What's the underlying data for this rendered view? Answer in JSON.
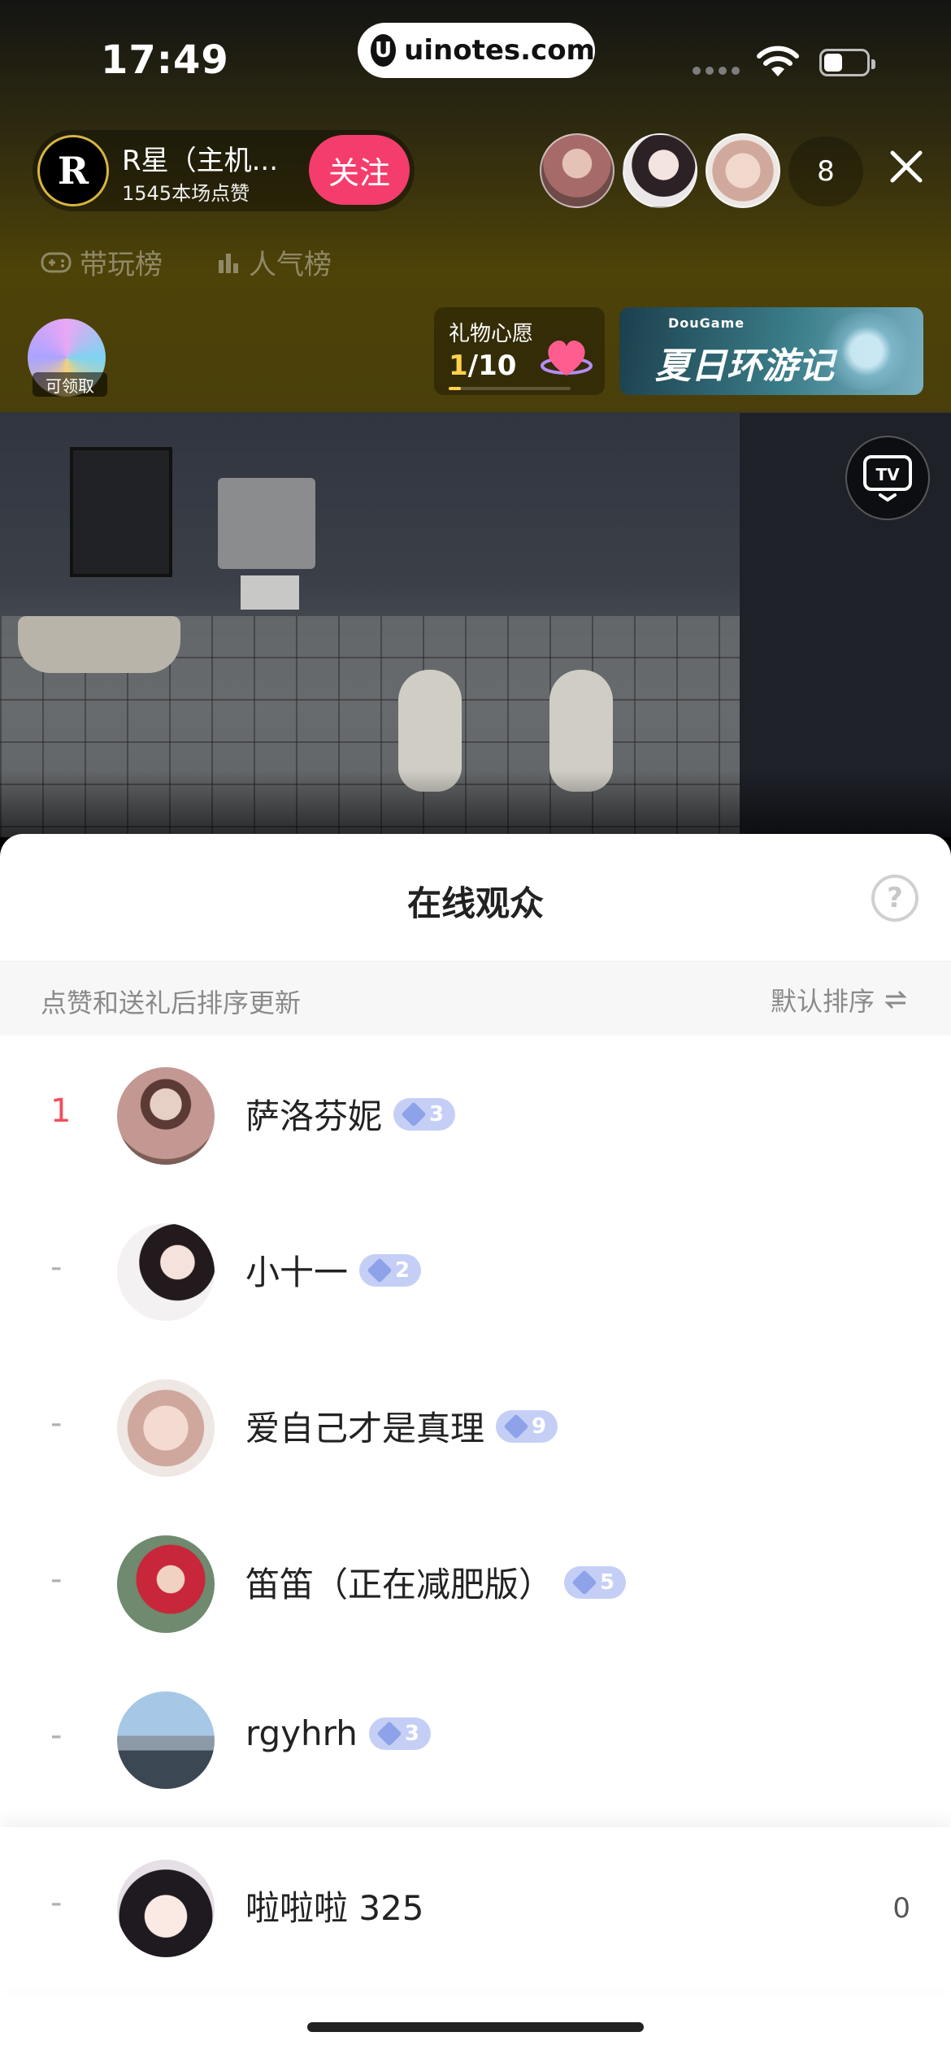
{
  "status_bar": {
    "time": "17:49",
    "url": "uinotes.com"
  },
  "streamer": {
    "name": "R星（主机...",
    "likes": "1545本场点赞",
    "avatar_letter": "R",
    "follow_label": "关注"
  },
  "viewers": {
    "count": "8"
  },
  "tabs": [
    {
      "icon": "gamepad-icon",
      "label": "带玩榜"
    },
    {
      "icon": "bar-chart-icon",
      "label": "人气榜"
    }
  ],
  "reward": {
    "label": "可领取"
  },
  "gift_wish": {
    "title": "礼物心愿",
    "current": "1",
    "separator_total": "/10",
    "progress": 0.1
  },
  "event_banner": {
    "brand": "DouGame",
    "title": "夏日环游记"
  },
  "sheet": {
    "title": "在线观众",
    "subtitle": "点赞和送礼后排序更新",
    "sort_label": "默认排序"
  },
  "audience": [
    {
      "rank": "1",
      "name": "萨洛芬妮",
      "level": "3"
    },
    {
      "rank": "-",
      "name": "小十一",
      "level": "2"
    },
    {
      "rank": "-",
      "name": "爱自己才是真理",
      "level": "9"
    },
    {
      "rank": "-",
      "name": "笛笛（正在减肥版）",
      "level": "5"
    },
    {
      "rank": "-",
      "name": "rgyhrh",
      "level": "3"
    }
  ],
  "self": {
    "rank": "-",
    "name": "啦啦啦 325",
    "count": "0"
  },
  "colors": {
    "follow_button": "#f43d6d",
    "rank_highlight": "#f04f5b",
    "level_badge": "#c5cff6",
    "gift_progress": "#ffd24a"
  }
}
